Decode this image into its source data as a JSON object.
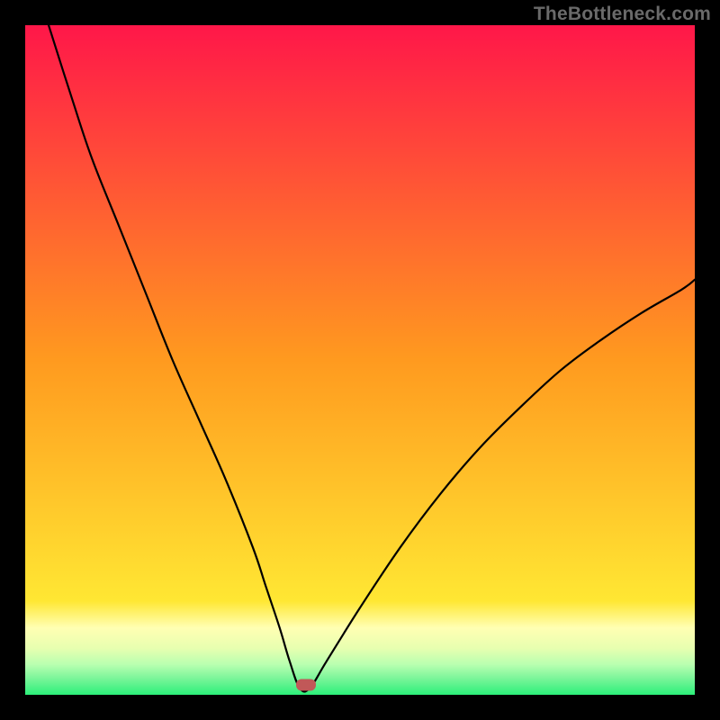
{
  "watermark": "TheBottleneck.com",
  "colors": {
    "red": "#ff1749",
    "orange": "#ff9a1f",
    "yellow": "#ffe733",
    "pale": "#ffffb3",
    "green": "#2cf07a",
    "curve": "#000000",
    "frame": "#000000",
    "marker": "#c15858"
  },
  "chart_data": {
    "type": "line",
    "title": "",
    "xlabel": "",
    "ylabel": "",
    "xlim": [
      0,
      100
    ],
    "ylim": [
      0,
      100
    ],
    "x": [
      3.5,
      7,
      10,
      14,
      18,
      22,
      26,
      30,
      34,
      36,
      38,
      39.5,
      41,
      42.5,
      45,
      50,
      56,
      62,
      68,
      74,
      80,
      86,
      92,
      98,
      100
    ],
    "y": [
      100,
      89,
      80,
      70,
      60,
      50,
      41,
      32,
      22,
      16,
      10,
      5,
      1,
      1,
      5,
      13,
      22,
      30,
      37,
      43,
      48.5,
      53,
      57,
      60.5,
      62
    ],
    "marker": {
      "x": 42,
      "y": 1.5
    },
    "gradient_bands": [
      {
        "stop": 0.0,
        "value": 100
      },
      {
        "stop": 0.5,
        "value": 50
      },
      {
        "stop": 0.9,
        "value": 10
      },
      {
        "stop": 0.97,
        "value": 3
      },
      {
        "stop": 1.0,
        "value": 0
      }
    ]
  }
}
